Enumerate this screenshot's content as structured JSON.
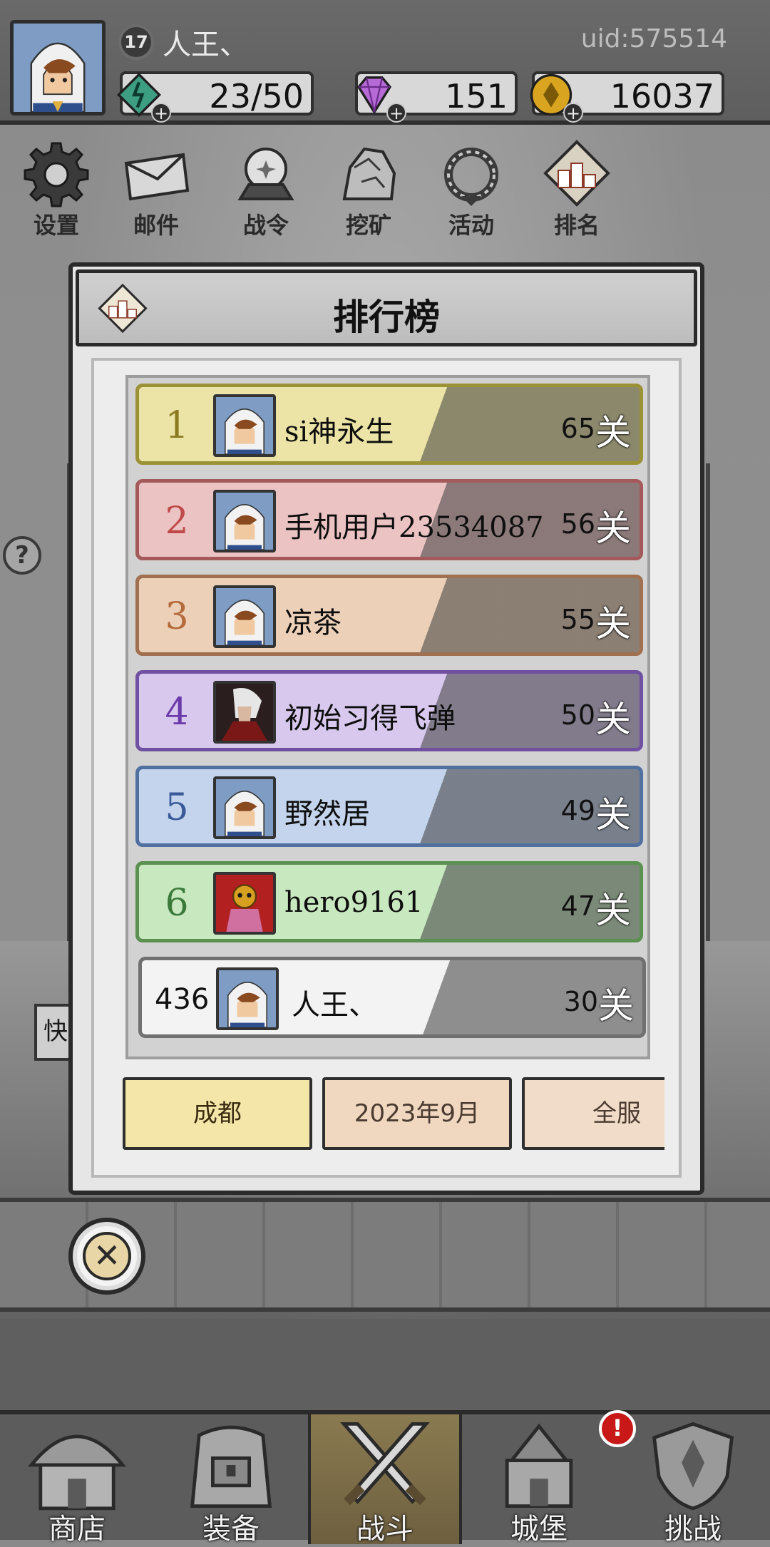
{
  "header": {
    "level": "17",
    "player_name": "人王、",
    "uid": "uid:575514",
    "resources": [
      {
        "name": "stamina",
        "value": "23/50",
        "icon": "green-gem-icon"
      },
      {
        "name": "diamond",
        "value": "151",
        "icon": "purple-diamond-icon"
      },
      {
        "name": "gold",
        "value": "16037",
        "icon": "gold-coin-icon"
      }
    ]
  },
  "menu": [
    {
      "label": "设置",
      "icon": "gear-icon"
    },
    {
      "label": "邮件",
      "icon": "envelope-icon"
    },
    {
      "label": "战令",
      "icon": "crystal-ball-icon"
    },
    {
      "label": "挖矿",
      "icon": "ore-rock-icon"
    },
    {
      "label": "活动",
      "icon": "wreath-icon"
    },
    {
      "label": "排名",
      "icon": "ranking-podium-icon"
    }
  ],
  "leaderboard": {
    "title": "排行榜",
    "unit": "关",
    "rows": [
      {
        "rank": "1",
        "name": "si神永生",
        "score": "65"
      },
      {
        "rank": "2",
        "name": "手机用户23534087",
        "score": "56"
      },
      {
        "rank": "3",
        "name": "凉茶",
        "score": "55"
      },
      {
        "rank": "4",
        "name": "初始习得飞弹",
        "score": "50"
      },
      {
        "rank": "5",
        "name": "野然居",
        "score": "49"
      },
      {
        "rank": "6",
        "name": "hero9161",
        "score": "47"
      }
    ],
    "me": {
      "rank": "436",
      "name": "人王、",
      "score": "30"
    },
    "tabs": [
      "成都",
      "2023年9月",
      "全服"
    ]
  },
  "background": {
    "help": "?",
    "fast": "快"
  },
  "bottom_nav": [
    {
      "label": "商店",
      "icon": "shop-hut-icon"
    },
    {
      "label": "装备",
      "icon": "backpack-icon"
    },
    {
      "label": "战斗",
      "icon": "crossed-swords-icon"
    },
    {
      "label": "城堡",
      "icon": "castle-icon"
    },
    {
      "label": "挑战",
      "icon": "shield-crest-icon"
    }
  ],
  "alert_badge": "!"
}
